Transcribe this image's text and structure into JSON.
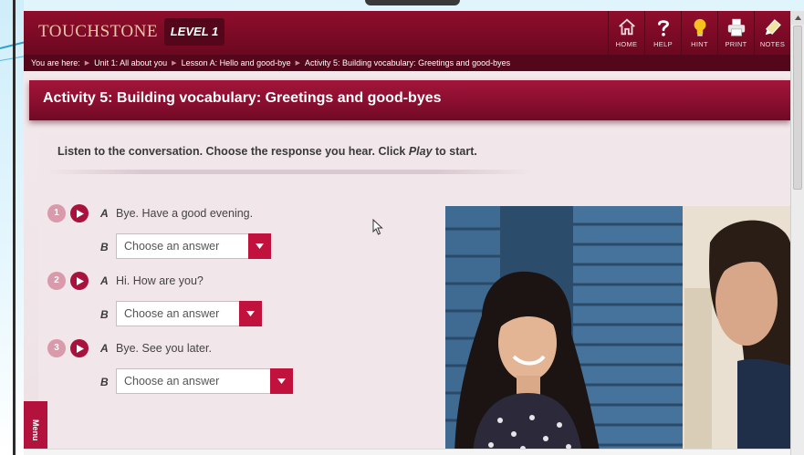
{
  "brand": {
    "logo": "TOUCHSTONE",
    "level": "LEVEL 1"
  },
  "toolbar": [
    {
      "label": "HOME",
      "icon": "home-icon"
    },
    {
      "label": "HELP",
      "icon": "help-icon"
    },
    {
      "label": "HINT",
      "icon": "lightbulb-icon"
    },
    {
      "label": "PRINT",
      "icon": "printer-icon"
    },
    {
      "label": "NOTES",
      "icon": "notes-icon"
    }
  ],
  "breadcrumb": {
    "prefix": "You are here:",
    "items": [
      "Unit 1: All about you",
      "Lesson A: Hello and good-bye",
      "Activity 5: Building vocabulary: Greetings and good-byes"
    ]
  },
  "activity": {
    "title": "Activity 5: Building vocabulary: Greetings and good-byes",
    "instruction_pre": "Listen to the conversation. Choose the response you hear. Click ",
    "instruction_em": "Play",
    "instruction_post": " to start."
  },
  "items": [
    {
      "number": "1",
      "speaker_a": "A",
      "line_a": "Bye. Have a good evening.",
      "speaker_b": "B",
      "select_value": "Choose an answer"
    },
    {
      "number": "2",
      "speaker_a": "A",
      "line_a": "Hi. How are you?",
      "speaker_b": "B",
      "select_value": "Choose an answer"
    },
    {
      "number": "3",
      "speaker_a": "A",
      "line_a": "Bye. See you later.",
      "speaker_b": "B",
      "select_value": "Choose an answer"
    }
  ],
  "menu_tab": "Menu",
  "colors": {
    "brand_dark": "#7a0a25",
    "accent": "#c1123e",
    "number_badge": "#d99aab"
  }
}
